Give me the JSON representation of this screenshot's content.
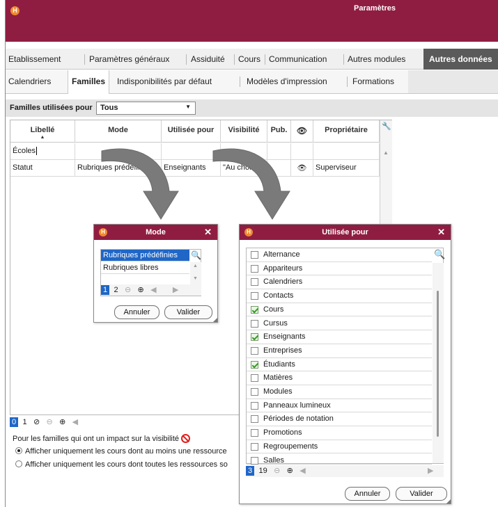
{
  "window": {
    "title": "Paramètres",
    "logo": "H"
  },
  "main_tabs": [
    {
      "label": "Etablissement"
    },
    {
      "label": "Paramètres généraux"
    },
    {
      "label": "Assiduité"
    },
    {
      "label": "Cours"
    },
    {
      "label": "Communication"
    },
    {
      "label": "Autres modules"
    },
    {
      "label": "Autres données",
      "active": true
    }
  ],
  "sub_tabs": [
    {
      "label": "Calendriers"
    },
    {
      "label": "Familles",
      "active": true
    },
    {
      "label": "Indisponibilités par défaut"
    },
    {
      "label": "Modèles d'impression"
    },
    {
      "label": "Formations"
    }
  ],
  "filter": {
    "label": "Familles utilisées pour",
    "value": "Tous"
  },
  "grid": {
    "columns": [
      "Libellé",
      "Mode",
      "Utilisée pour",
      "Visibilité",
      "Pub.",
      "eye-icon",
      "Propriétaire"
    ],
    "rows": [
      {
        "libelle": "Écoles",
        "mode": "",
        "utilisee": "",
        "visibilite": "",
        "pub": "",
        "eye": false,
        "proprietaire": ""
      },
      {
        "libelle": "Statut",
        "mode": "Rubriques prédéfinies",
        "utilisee": "Enseignants",
        "visibilite": "\"Au choix\"",
        "pub": "",
        "eye": true,
        "proprietaire": "Superviseur"
      }
    ],
    "footer_pages": [
      "0",
      "1"
    ]
  },
  "visibility_note": "Pour les familles qui ont un impact sur la visibilité",
  "radio_options": [
    {
      "label": "Afficher uniquement les cours dont au moins une ressource",
      "checked": true
    },
    {
      "label": "Afficher uniquement les cours dont toutes les ressources so",
      "checked": false
    }
  ],
  "mode_dialog": {
    "title": "Mode",
    "items": [
      {
        "label": "Rubriques prédéfinies",
        "selected": true
      },
      {
        "label": "Rubriques libres",
        "selected": false
      }
    ],
    "pages": [
      "1",
      "2"
    ],
    "cancel": "Annuler",
    "ok": "Valider"
  },
  "utilisee_dialog": {
    "title": "Utilisée pour",
    "items": [
      {
        "label": "Alternance",
        "checked": false
      },
      {
        "label": "Appariteurs",
        "checked": false
      },
      {
        "label": "Calendriers",
        "checked": false
      },
      {
        "label": "Contacts",
        "checked": false
      },
      {
        "label": "Cours",
        "checked": true
      },
      {
        "label": "Cursus",
        "checked": false
      },
      {
        "label": "Enseignants",
        "checked": true
      },
      {
        "label": "Entreprises",
        "checked": false
      },
      {
        "label": "Étudiants",
        "checked": true
      },
      {
        "label": "Matières",
        "checked": false
      },
      {
        "label": "Modules",
        "checked": false
      },
      {
        "label": "Panneaux lumineux",
        "checked": false
      },
      {
        "label": "Périodes de notation",
        "checked": false
      },
      {
        "label": "Promotions",
        "checked": false
      },
      {
        "label": "Regroupements",
        "checked": false
      },
      {
        "label": "Salles",
        "checked": false
      }
    ],
    "selected_count": "3",
    "total_count": "19",
    "cancel": "Annuler",
    "ok": "Valider"
  },
  "colors": {
    "brand": "#8f1d42",
    "active_tab": "#5a5a5a",
    "selection": "#1f66c7",
    "logo": "#f08a2e"
  }
}
